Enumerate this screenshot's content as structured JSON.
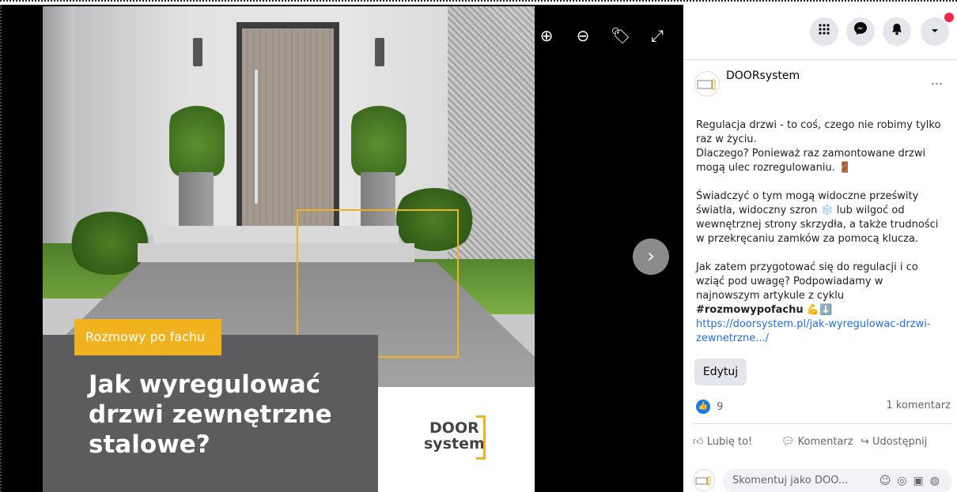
{
  "viewer": {
    "image": {
      "tag_label": "Rozmowy po fachu",
      "headline": "Jak wyregulować drzwi zewnętrzne stalowe?",
      "logo_top": "DOOR",
      "logo_bottom": "system"
    },
    "controls": {
      "zoom_in": "⊕",
      "zoom_out": "⊖",
      "tag": "🏷",
      "fullscreen": "⤢",
      "next": "›"
    }
  },
  "topbar": {
    "icons": [
      "menu-grid-icon",
      "messenger-icon",
      "notifications-icon",
      "account-dropdown-icon"
    ]
  },
  "post": {
    "page_name": "DOORsystem",
    "more": "...",
    "paragraphs": [
      "Regulacja drzwi - to coś, czego nie robimy tylko raz w życiu.\nDlaczego? Ponieważ raz zamontowane drzwi mogą ulec rozregulowaniu. 🚪",
      "Świadczyć o tym mogą widoczne prześwity światła, widoczny szron ❄️ lub wilgoć od wewnętrznej strony skrzydła, a także trudności w przekręcaniu zamków za pomocą klucza."
    ],
    "paragraph3_text": "Jak zatem przygotować się do regulacji i co wziąć pod uwagę? Podpowiadamy w najnowszym artykule z cyklu ",
    "hashtag": "#rozmowypofachu",
    "emoji_suffix": " 💪⬇️",
    "link": "https://doorsystem.pl/jak-wyregulowac-drzwi-zewnetrzne.../",
    "edit_label": "Edytuj",
    "like_count": "9",
    "comments_count": "1 komentarz",
    "actions": {
      "like": "Lubię to!",
      "comment": "Komentarz",
      "share": "Udostępnij"
    },
    "comment_placeholder": "Skomentuj jako DOO..."
  },
  "colors": {
    "accent": "#f0b21f",
    "link": "#216fdb",
    "like_blue": "#1877f2",
    "notification_red": "#f02849"
  }
}
